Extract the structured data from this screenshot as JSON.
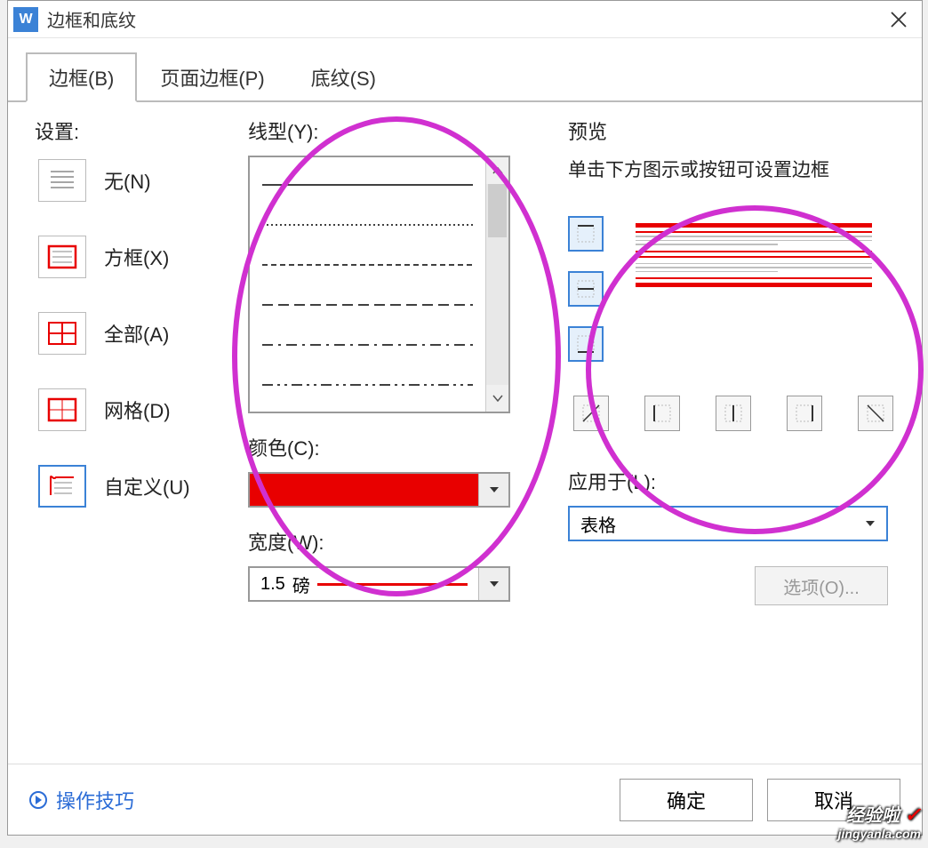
{
  "title": "边框和底纹",
  "tabs": {
    "border": "边框(B)",
    "page_border": "页面边框(P)",
    "shading": "底纹(S)"
  },
  "settings": {
    "label": "设置:",
    "items": [
      {
        "label": "无(N)"
      },
      {
        "label": "方框(X)"
      },
      {
        "label": "全部(A)"
      },
      {
        "label": "网格(D)"
      },
      {
        "label": "自定义(U)"
      }
    ]
  },
  "style": {
    "line_label": "线型(Y):",
    "color_label": "颜色(C):",
    "color_value": "#E80000",
    "width_label": "宽度(W):",
    "width_value": "1.5",
    "width_unit": "磅"
  },
  "preview": {
    "label": "预览",
    "hint": "单击下方图示或按钮可设置边框"
  },
  "apply": {
    "label": "应用于(L):",
    "value": "表格"
  },
  "options_btn": "选项(O)...",
  "tips_link": "操作技巧",
  "ok_btn": "确定",
  "cancel_btn": "取消",
  "watermark_top": "经验啦",
  "watermark_bottom": "jingyanla.com"
}
